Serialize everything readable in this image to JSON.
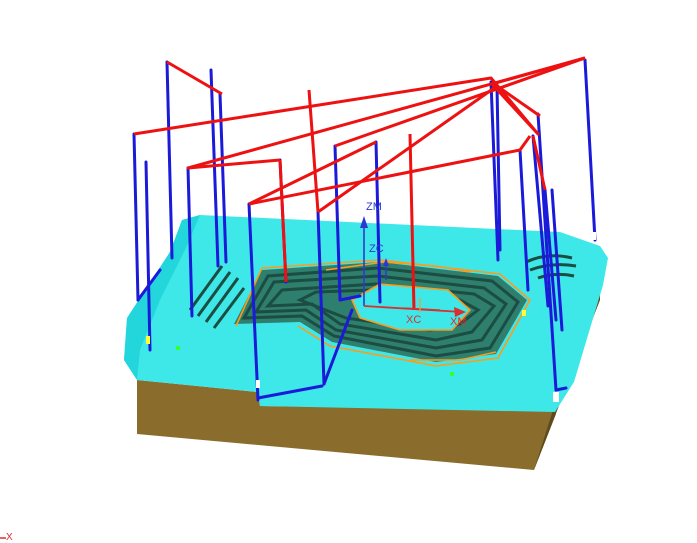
{
  "axes": {
    "zm": "ZM",
    "zc": "ZC",
    "xc": "XC",
    "xm": "XM",
    "triad_x": "X"
  },
  "icons": {
    "csys": "work-coordinate-system-icon",
    "triad": "view-triad-icon"
  },
  "colors": {
    "block_top": "#3fe8e8",
    "block_top_shade": "#22d6dc",
    "block_side": "#8a6d2c",
    "block_side_dark": "#5e4a1d",
    "pocket_floor": "#2f7f6e",
    "pocket_stripe": "#1b4d42",
    "cut_path": "#1a1ad8",
    "rapid_path": "#ee1111",
    "contour_path": "#ff9a1a",
    "csys_z": "#2a3ad0",
    "csys_x": "#d83030"
  }
}
